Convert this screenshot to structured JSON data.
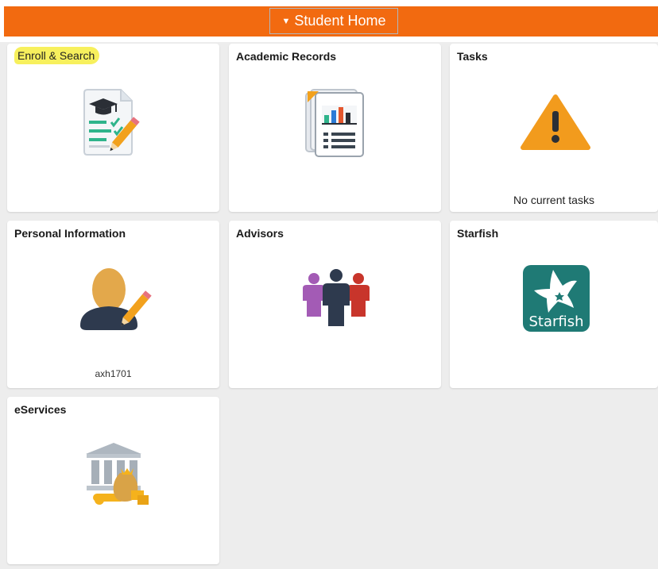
{
  "header": {
    "title": "Student Home",
    "caret": "▼",
    "bar_color": "#f26a10"
  },
  "tiles": [
    {
      "title": "Enroll & Search",
      "icon": "enroll-document-icon",
      "highlighted": true
    },
    {
      "title": "Academic Records",
      "icon": "academic-records-icon"
    },
    {
      "title": "Tasks",
      "icon": "warning-icon",
      "caption": "No current tasks"
    },
    {
      "title": "Personal Information",
      "icon": "person-edit-icon",
      "caption": "axh1701"
    },
    {
      "title": "Advisors",
      "icon": "advisors-group-icon"
    },
    {
      "title": "Starfish",
      "icon": "starfish-logo-icon",
      "logo_text": "Starfish"
    },
    {
      "title": "eServices",
      "icon": "bank-money-icon"
    }
  ],
  "colors": {
    "highlight": "#f7f05d",
    "warning": "#f29b1d",
    "starfish_teal": "#1f7a75"
  }
}
